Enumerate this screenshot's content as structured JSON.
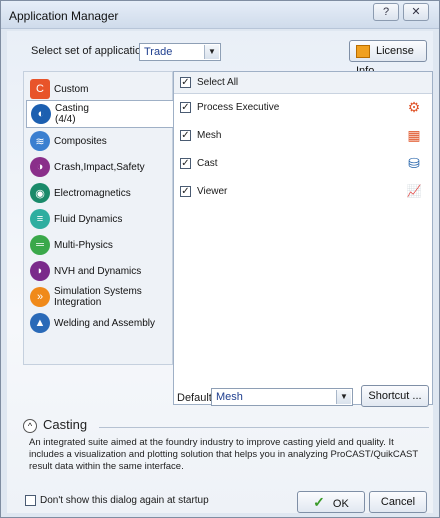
{
  "window": {
    "title": "Application Manager",
    "help_label": "?",
    "close_label": "✕"
  },
  "top": {
    "select_label": "Select set of application:",
    "select_value": "Trade",
    "license_label": "License Info"
  },
  "categories": [
    {
      "label": "Custom",
      "icon": "custom-icon",
      "color": "#e8542a",
      "glyph": "C"
    },
    {
      "label": "Casting",
      "sub": "(4/4)",
      "icon": "casting-icon",
      "color": "#1c5fb0",
      "glyph": "◐"
    },
    {
      "label": "Composites",
      "icon": "composites-icon",
      "color": "#3a7fd0",
      "glyph": "≋"
    },
    {
      "label": "Crash,Impact,Safety",
      "icon": "crash-icon",
      "color": "#8a2f8a",
      "glyph": "◑"
    },
    {
      "label": "Electromagnetics",
      "icon": "electromagnetics-icon",
      "color": "#1a8a6a",
      "glyph": "◉"
    },
    {
      "label": "Fluid Dynamics",
      "icon": "fluid-icon",
      "color": "#2eaea0",
      "glyph": "≡"
    },
    {
      "label": "Multi-Physics",
      "icon": "multiphysics-icon",
      "color": "#3aa84a",
      "glyph": "═"
    },
    {
      "label": "NVH and Dynamics",
      "icon": "nvh-icon",
      "color": "#7a2a8a",
      "glyph": "◗"
    },
    {
      "label": "Simulation Systems Integration",
      "icon": "ssi-icon",
      "color": "#f08a1a",
      "glyph": "»"
    },
    {
      "label": "Welding and Assembly",
      "icon": "welding-icon",
      "color": "#2a6ab8",
      "glyph": "▲"
    }
  ],
  "apps": {
    "select_all": "Select All",
    "items": [
      {
        "label": "Process Executive",
        "icon": "process-executive-icon",
        "color": "#e0552a",
        "glyph": "⚙"
      },
      {
        "label": "Mesh",
        "icon": "mesh-icon",
        "color": "#e0552a",
        "glyph": "▦"
      },
      {
        "label": "Cast",
        "icon": "cast-icon",
        "color": "#1f5fa8",
        "glyph": "⛁"
      },
      {
        "label": "Viewer",
        "icon": "viewer-icon",
        "color": "#e0552a",
        "glyph": "📈"
      }
    ],
    "check_glyph": "✓"
  },
  "bottom": {
    "default_label": "Default",
    "default_value": "Mesh",
    "shortcut_label": "Shortcut ...",
    "info_title": "Casting",
    "info_desc": "An integrated suite aimed at the foundry industry to improve casting yield and quality. It includes a visualization and plotting solution that helps you in analyzing ProCAST/QuikCAST result data within the same interface.",
    "dont_show_label": "Don't show this dialog again at startup",
    "ok_label": "OK",
    "cancel_label": "Cancel"
  }
}
